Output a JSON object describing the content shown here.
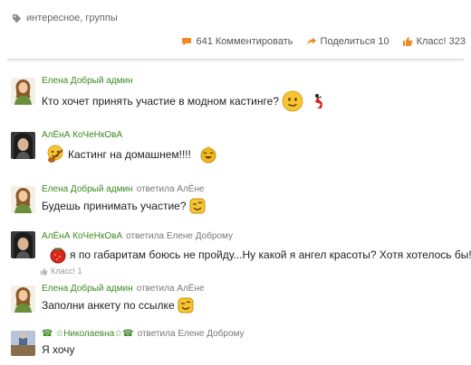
{
  "tags": {
    "text": "интересное, группы",
    "icon": "tag-icon"
  },
  "actions": {
    "comments": "641 Комментировать",
    "share": "Поделиться 10",
    "like": "Класс! 323"
  },
  "comments": [
    {
      "author": "Елена Добрый админ",
      "reply_to": "",
      "text": "Кто хочет принять участие в модном кастинге?"
    },
    {
      "author": "АлЁнА КоЧеНкОвА",
      "reply_to": "",
      "text": "Кастинг на домашнем!!!!"
    },
    {
      "author": "Елена Добрый админ",
      "reply_to": "ответила АлЁне",
      "text": "Будешь принимать участие?"
    },
    {
      "author": "АлЁнА КоЧеНкОвА",
      "reply_to": "ответила Елене Доброму",
      "text": "я по габаритам боюсь не пройду...Ну какой я ангел красоты? Хотя хотелось бы!",
      "likes": "Класс! 1"
    },
    {
      "author": "Елена Добрый админ",
      "reply_to": "ответила АлЁне",
      "text": "Заполни анкету по ссылке"
    },
    {
      "author": "☎ ☆Николаевна☆☎",
      "reply_to": "ответила Елене Доброму",
      "text": "Я хочу"
    }
  ]
}
